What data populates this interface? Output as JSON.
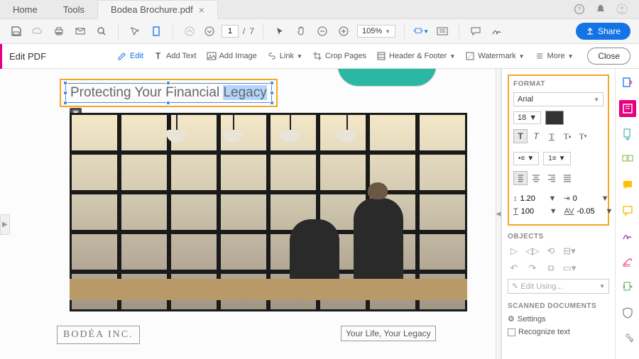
{
  "tabs": {
    "home": "Home",
    "tools": "Tools",
    "file": "Bodea Brochure.pdf"
  },
  "page": {
    "current": "1",
    "sep": "/",
    "total": "7"
  },
  "zoom": "105%",
  "share": "Share",
  "editbar": {
    "title": "Edit PDF",
    "edit": "Edit",
    "addText": "Add Text",
    "addImage": "Add Image",
    "link": "Link",
    "crop": "Crop Pages",
    "headerFooter": "Header & Footer",
    "watermark": "Watermark",
    "more": "More",
    "close": "Close"
  },
  "doc": {
    "titlePlain": "Protecting Your Financial ",
    "titleHighlight": "Legacy",
    "logo": "BODÉA INC.",
    "tagline": "Your Life, Your Legacy"
  },
  "format": {
    "heading": "FORMAT",
    "font": "Arial",
    "size": "18",
    "lineHeight": "1.20",
    "indent": "0",
    "scale": "100",
    "tracking": "-0.05"
  },
  "objects": {
    "heading": "OBJECTS",
    "editUsing": "Edit Using..."
  },
  "scanned": {
    "heading": "SCANNED DOCUMENTS",
    "settings": "Settings",
    "recognize": "Recognize text"
  }
}
